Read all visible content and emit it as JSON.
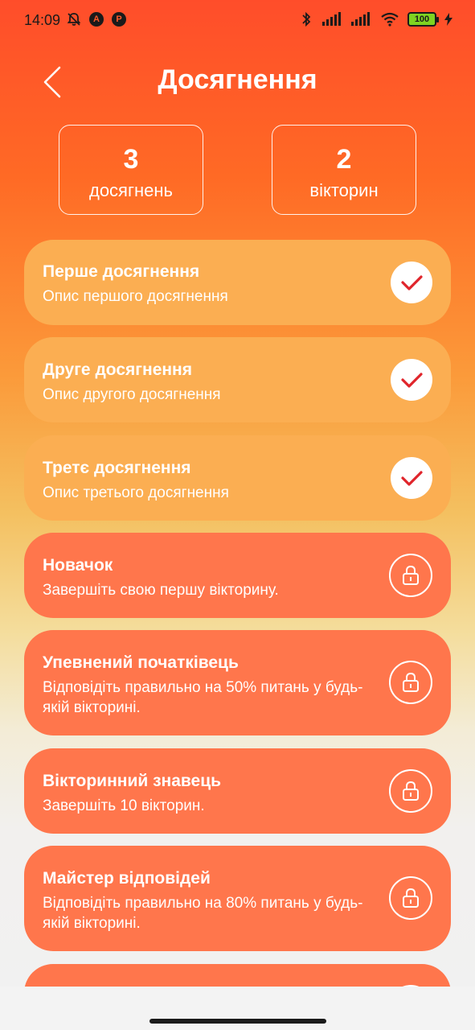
{
  "status_bar": {
    "time": "14:09",
    "battery": "100",
    "icons": [
      "bell-off-icon",
      "app-a-icon",
      "pinterest-icon",
      "bluetooth-icon",
      "signal-icon",
      "signal-icon",
      "wifi-icon",
      "battery-icon",
      "charging-icon"
    ]
  },
  "header": {
    "title": "Досягнення",
    "back_icon": "chevron-left-icon"
  },
  "stats": [
    {
      "value": "3",
      "label": "досягнень"
    },
    {
      "value": "2",
      "label": "вікторин"
    }
  ],
  "achievements": [
    {
      "title": "Перше досягнення",
      "description": "Опис першого досягнення",
      "status": "done"
    },
    {
      "title": "Друге досягнення",
      "description": "Опис другого досягнення",
      "status": "done"
    },
    {
      "title": "Третє досягнення",
      "description": "Опис третього досягнення",
      "status": "done"
    },
    {
      "title": "Новачок",
      "description": "Завершіть свою першу вікторину.",
      "status": "locked"
    },
    {
      "title": "Упевнений початківець",
      "description": "Відповідіть правильно на 50% питань у будь-якій вікторині.",
      "status": "locked"
    },
    {
      "title": "Вікторинний знавець",
      "description": "Завершіть 10 вікторин.",
      "status": "locked"
    },
    {
      "title": "Майстер відповідей",
      "description": "Відповідіть правильно на 80% питань у будь-якій вікторині.",
      "status": "locked"
    }
  ],
  "colors": {
    "accent": "#ff5a2a",
    "card_done": "#fbae52",
    "card_locked": "#ff764c",
    "check": "#e0242b"
  }
}
